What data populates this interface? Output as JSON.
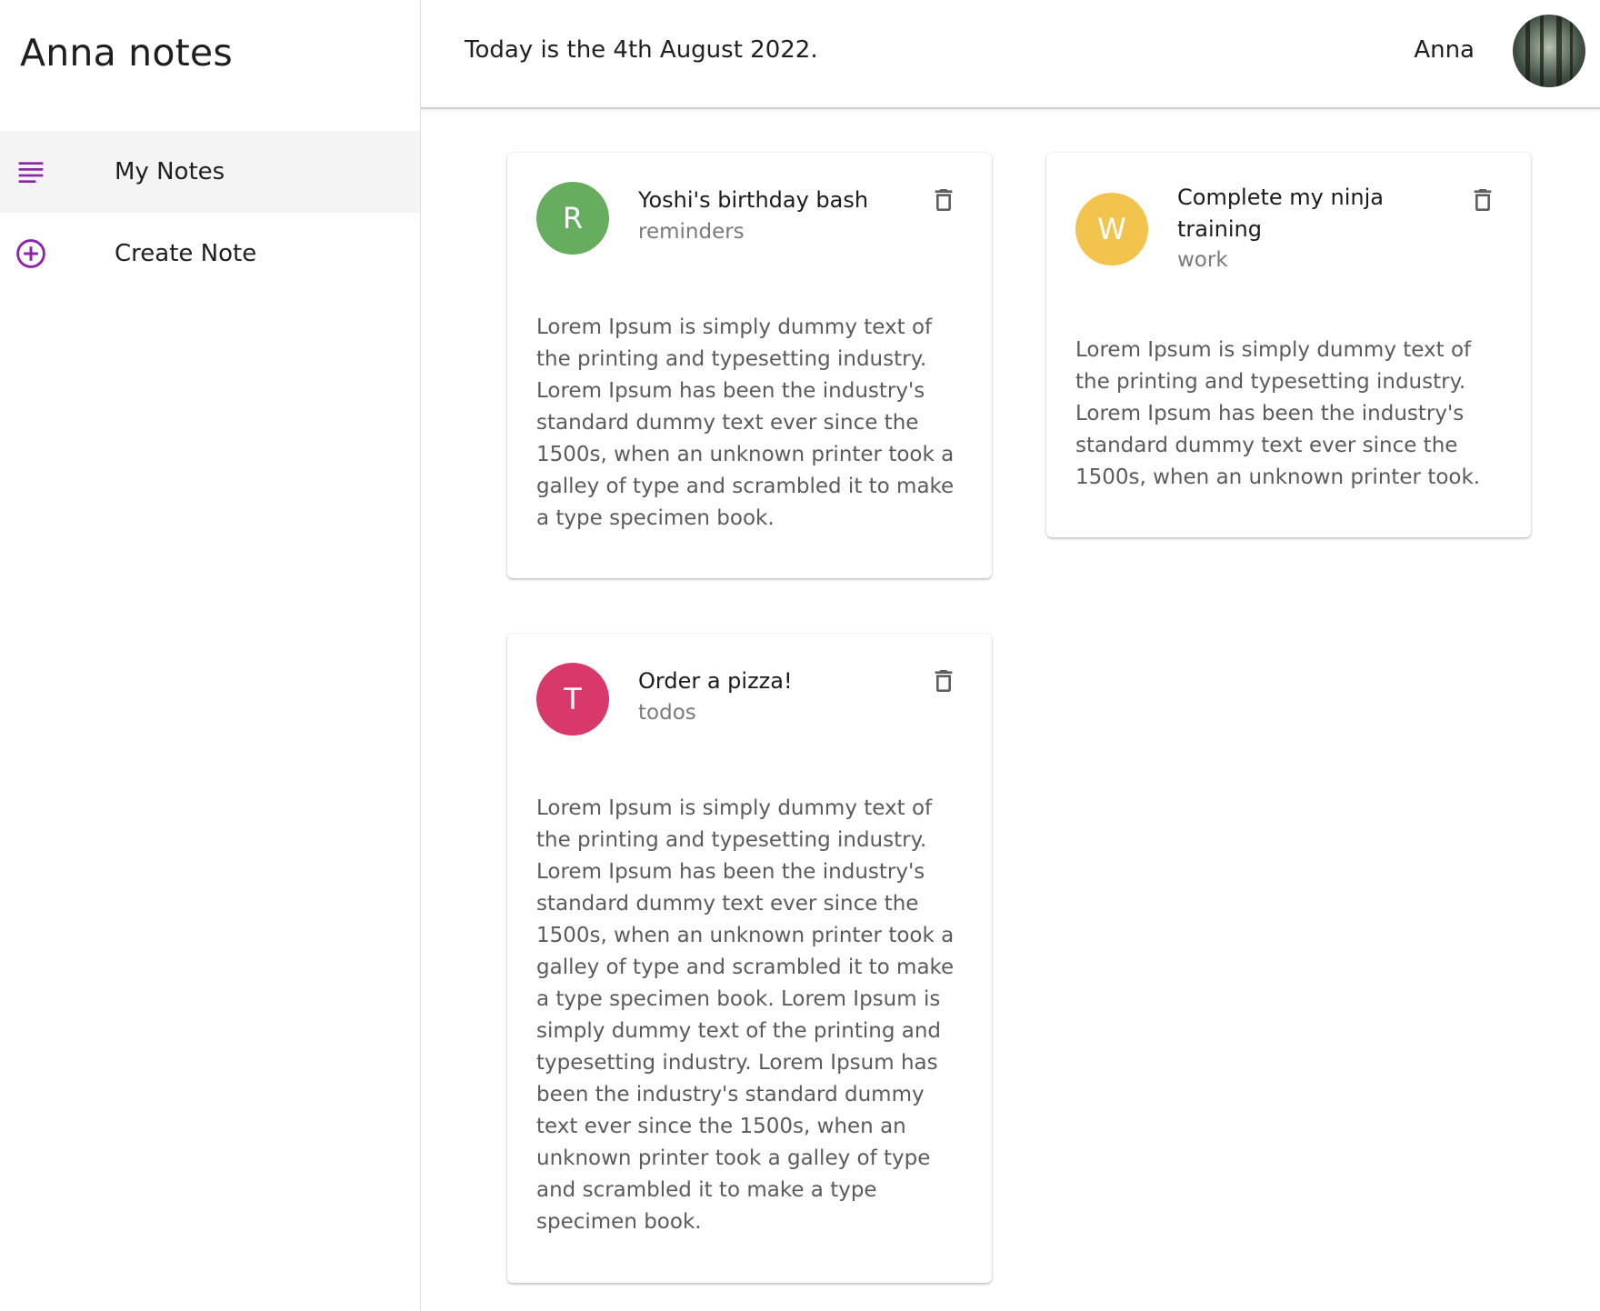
{
  "app": {
    "title": "Anna notes"
  },
  "sidebar": {
    "items": [
      {
        "label": "My Notes",
        "icon": "subject-icon",
        "active": true
      },
      {
        "label": "Create Note",
        "icon": "add-circle-icon",
        "active": false
      }
    ]
  },
  "header": {
    "date_text": "Today is the 4th August 2022.",
    "user_name": "Anna"
  },
  "notes": [
    {
      "initial": "R",
      "title": "Yoshi's birthday bash",
      "category": "reminders",
      "details": "Lorem Ipsum is simply dummy text of the printing and typesetting industry. Lorem Ipsum has been the industry's standard dummy text ever since the 1500s, when an unknown printer took a galley of type and scrambled it to make a type specimen book.",
      "color": "#66ad5f"
    },
    {
      "initial": "W",
      "title": "Complete my ninja training",
      "category": "work",
      "details": "Lorem Ipsum is simply dummy text of the printing and typesetting industry. Lorem Ipsum has been the industry's standard dummy text ever since the 1500s, when an unknown printer took.",
      "color": "#f2c34d"
    },
    {
      "initial": "T",
      "title": "Order a pizza!",
      "category": "todos",
      "details": "Lorem Ipsum is simply dummy text of the printing and typesetting industry. Lorem Ipsum has been the industry's standard dummy text ever since the 1500s, when an unknown printer took a galley of type and scrambled it to make a type specimen book. Lorem Ipsum is simply dummy text of the printing and typesetting industry. Lorem Ipsum has been the industry's standard dummy text ever since the 1500s, when an unknown printer took a galley of type and scrambled it to make a type specimen book.",
      "color": "#d8386a"
    }
  ],
  "colors": {
    "accent": "#8e24aa",
    "icon_gray": "#5f5f5f"
  }
}
